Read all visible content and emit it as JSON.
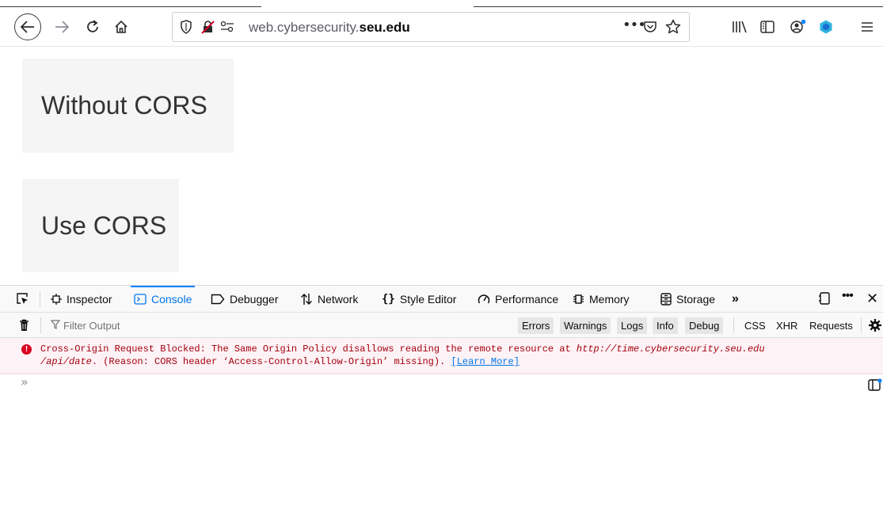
{
  "browser": {
    "url_plain": "web.cybersecurity.",
    "url_bold": "seu.edu",
    "page_actions": "•••"
  },
  "page": {
    "button_without_cors": "Without CORS",
    "button_use_cors": "Use CORS"
  },
  "devtools": {
    "tabs": [
      {
        "label": "Inspector"
      },
      {
        "label": "Console"
      },
      {
        "label": "Debugger"
      },
      {
        "label": "Network"
      },
      {
        "label": "Style Editor"
      },
      {
        "label": "Performance"
      },
      {
        "label": "Memory"
      },
      {
        "label": "Storage"
      }
    ],
    "overflow": "»",
    "more_menu": "•••",
    "close": "✕",
    "filter_placeholder": "Filter Output",
    "levels": [
      "Errors",
      "Warnings",
      "Logs",
      "Info",
      "Debug"
    ],
    "request_filters": [
      "CSS",
      "XHR",
      "Requests"
    ],
    "messages": [
      {
        "level": "error",
        "line1_prefix": "Cross-Origin Request Blocked: The Same Origin Policy disallows reading the remote resource at ",
        "url_part1": "http://time.cybersecurity.seu.edu",
        "url_part2": "/api/date",
        "line2_suffix": ". (Reason: CORS header ‘Access-Control-Allow-Origin’ missing). ",
        "link": "[Learn More]"
      }
    ],
    "prompt": "»"
  },
  "colors": {
    "accent": "#0a84ff",
    "error": "#d70022",
    "error_bg": "#fdf2f5"
  }
}
